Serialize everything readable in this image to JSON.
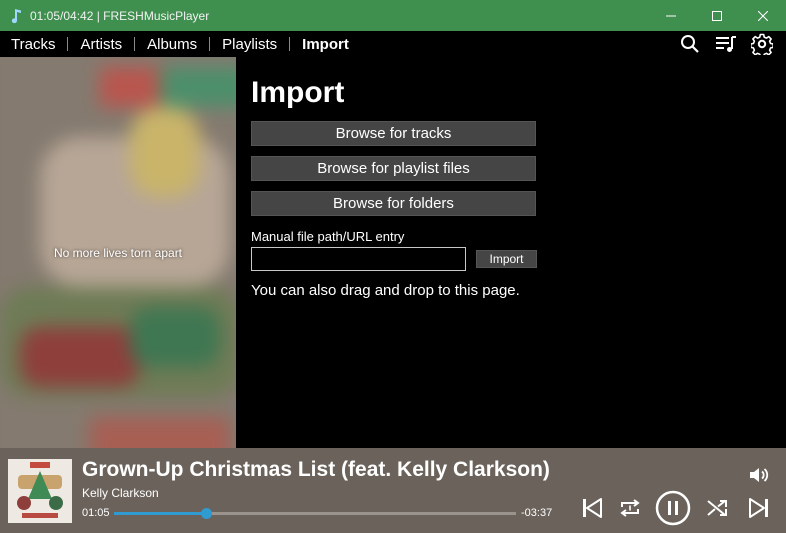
{
  "window": {
    "title": "01:05/04:42 | FRESHMusicPlayer",
    "titlebar_color": "#3f8f4f"
  },
  "nav": {
    "items": [
      {
        "label": "Tracks",
        "active": false
      },
      {
        "label": "Artists",
        "active": false
      },
      {
        "label": "Albums",
        "active": false
      },
      {
        "label": "Playlists",
        "active": false
      },
      {
        "label": "Import",
        "active": true
      }
    ],
    "actions": [
      {
        "icon": "search-icon"
      },
      {
        "icon": "queue-icon"
      },
      {
        "icon": "settings-gear-icon"
      }
    ]
  },
  "art_panel": {
    "lyric": "No more lives torn apart"
  },
  "import_page": {
    "title": "Import",
    "browse_tracks_label": "Browse for tracks",
    "browse_playlists_label": "Browse for playlist files",
    "browse_folders_label": "Browse for folders",
    "manual_entry_label": "Manual file path/URL entry",
    "manual_entry_value": "",
    "import_button_label": "Import",
    "drag_hint": "You can also drag and drop to this page."
  },
  "player": {
    "song_title": "Grown-Up Christmas List (feat. Kelly Clarkson)",
    "artist": "Kelly Clarkson",
    "time_current": "01:05",
    "time_remaining": "-03:37",
    "progress_fraction": 0.23,
    "background_color": "#6b635b",
    "accent_color": "#2f9bd0",
    "controls": [
      "previous-icon",
      "repeat-icon",
      "pause-icon",
      "shuffle-icon",
      "next-icon"
    ],
    "volume_icon": "volume-icon"
  }
}
